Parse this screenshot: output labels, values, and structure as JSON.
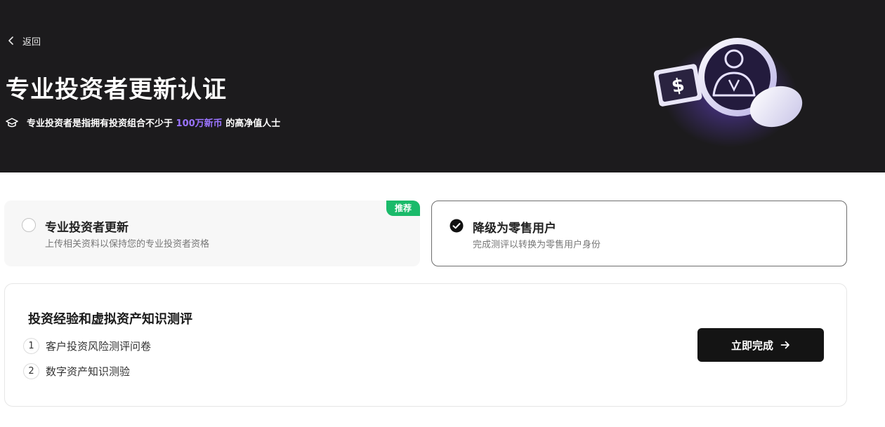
{
  "header": {
    "back_label": "返回",
    "title": "专业投资者更新认证",
    "subtitle_prefix": "专业投资者是指拥有投资组合不少于",
    "subtitle_highlight": "100万新币",
    "subtitle_suffix": "的高净值人士",
    "highlight_color": "#9b74ff"
  },
  "options": {
    "pro": {
      "title": "专业投资者更新",
      "description": "上传相关资料以保持您的专业投资者资格",
      "badge": "推荐",
      "selected": false
    },
    "retail": {
      "title": "降级为零售用户",
      "description": "完成测评以转换为零售用户身份",
      "selected": true
    }
  },
  "assessment": {
    "title": "投资经验和虚拟资产知识测评",
    "steps": [
      {
        "number": "1",
        "label": "客户投资风险测评问卷"
      },
      {
        "number": "2",
        "label": "数字资产知识测验"
      }
    ],
    "cta_label": "立即完成"
  },
  "colors": {
    "badge_green": "#1aba6a",
    "hero_bg": "#1c1b1d",
    "cta_bg": "#141414"
  }
}
